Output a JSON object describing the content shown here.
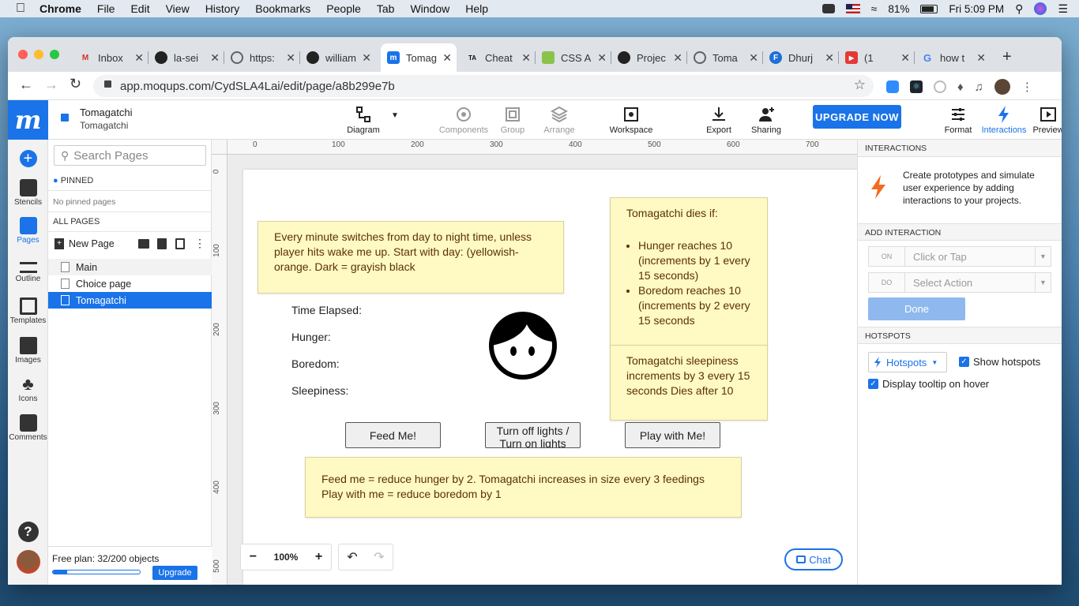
{
  "menubar": {
    "app": "Chrome",
    "items": [
      "File",
      "Edit",
      "View",
      "History",
      "Bookmarks",
      "People",
      "Tab",
      "Window",
      "Help"
    ],
    "battery": "81%",
    "clock": "Fri 5:09 PM"
  },
  "tabs": [
    {
      "title": "Inbox",
      "fav": "M",
      "color": "#d93025"
    },
    {
      "title": "la-sei",
      "fav": "gh",
      "color": "#222"
    },
    {
      "title": "https:",
      "fav": "g",
      "color": "#5f6368"
    },
    {
      "title": "william",
      "fav": "gh",
      "color": "#222"
    },
    {
      "title": "Tomag",
      "fav": "m",
      "color": "#1a73e8"
    },
    {
      "title": "Cheat",
      "fav": "TA",
      "color": "#111"
    },
    {
      "title": "CSS A",
      "fav": "w",
      "color": "#8bc34a"
    },
    {
      "title": "Projec",
      "fav": "gh",
      "color": "#222"
    },
    {
      "title": "Toma",
      "fav": "g",
      "color": "#5f6368"
    },
    {
      "title": "Dhurj",
      "fav": "F",
      "color": "#1e6fd9"
    },
    {
      "title": "(1",
      "fav": "▶",
      "color": "#e53935"
    },
    {
      "title": "how t",
      "fav": "G",
      "color": "#4285f4"
    }
  ],
  "url": "app.moqups.com/CydSLA4Lai/edit/page/a8b299e7b",
  "project": {
    "name": "Tomagatchi",
    "page": "Tomagatchi"
  },
  "toolbar": {
    "diagram": "Diagram",
    "components": "Components",
    "group": "Group",
    "arrange": "Arrange",
    "workspace": "Workspace",
    "export": "Export",
    "sharing": "Sharing",
    "upgrade": "UPGRADE NOW",
    "format": "Format",
    "interactions": "Interactions",
    "preview": "Preview"
  },
  "rail": {
    "stencils": "Stencils",
    "pages": "Pages",
    "outline": "Outline",
    "templates": "Templates",
    "images": "Images",
    "icons": "Icons",
    "comments": "Comments"
  },
  "pages_panel": {
    "search_placeholder": "Search Pages",
    "pinned": "PINNED",
    "no_pinned": "No pinned pages",
    "all_pages": "ALL PAGES",
    "new_page": "New Page",
    "pages": [
      "Main",
      "Choice page",
      "Tomagatchi"
    ],
    "plan": "Free plan: 32/200 objects",
    "plan_progress": 0.16,
    "upgrade": "Upgrade"
  },
  "ruler": {
    "x": [
      "0",
      "100",
      "200",
      "300",
      "400",
      "500",
      "600",
      "700"
    ],
    "y": [
      "0",
      "100",
      "200",
      "300",
      "400",
      "500"
    ]
  },
  "canvas": {
    "note1": "Every minute switches from day to night time, unless player hits wake me up. Start with day: (yellowish-orange. Dark = grayish black",
    "note2_title": "Tomagatchi dies if:",
    "note2_items": [
      "Hunger reaches 10 (increments by 1 every 15 seconds)",
      "Boredom reaches 10 (increments by 2 every 15 seconds"
    ],
    "note3": "Tomagatchi sleepiness increments by 3 every 15 seconds Dies after 10",
    "note4_line1": "Feed me = reduce hunger by 2. Tomagatchi increases in size every 3 feedings",
    "note4_line2": "Play with me = reduce boredom by 1",
    "labels": [
      "Time Elapsed:",
      "Hunger:",
      "Boredom:",
      "Sleepiness:"
    ],
    "btn_feed": "Feed Me!",
    "btn_lights": "Turn off lights / Turn on lights",
    "btn_play": "Play with Me!",
    "zoom": "100%",
    "chat": "Chat"
  },
  "interactions_panel": {
    "header": "INTERACTIONS",
    "desc": "Create prototypes and simulate user experience by adding interactions to your projects.",
    "add": "ADD INTERACTION",
    "on_tag": "ON",
    "on_val": "Click or Tap",
    "do_tag": "DO",
    "do_val": "Select Action",
    "done": "Done",
    "hotspots": "HOTSPOTS",
    "hotspots_btn": "Hotspots",
    "show_hotspots": "Show hotspots",
    "tooltip": "Display tooltip on hover"
  }
}
